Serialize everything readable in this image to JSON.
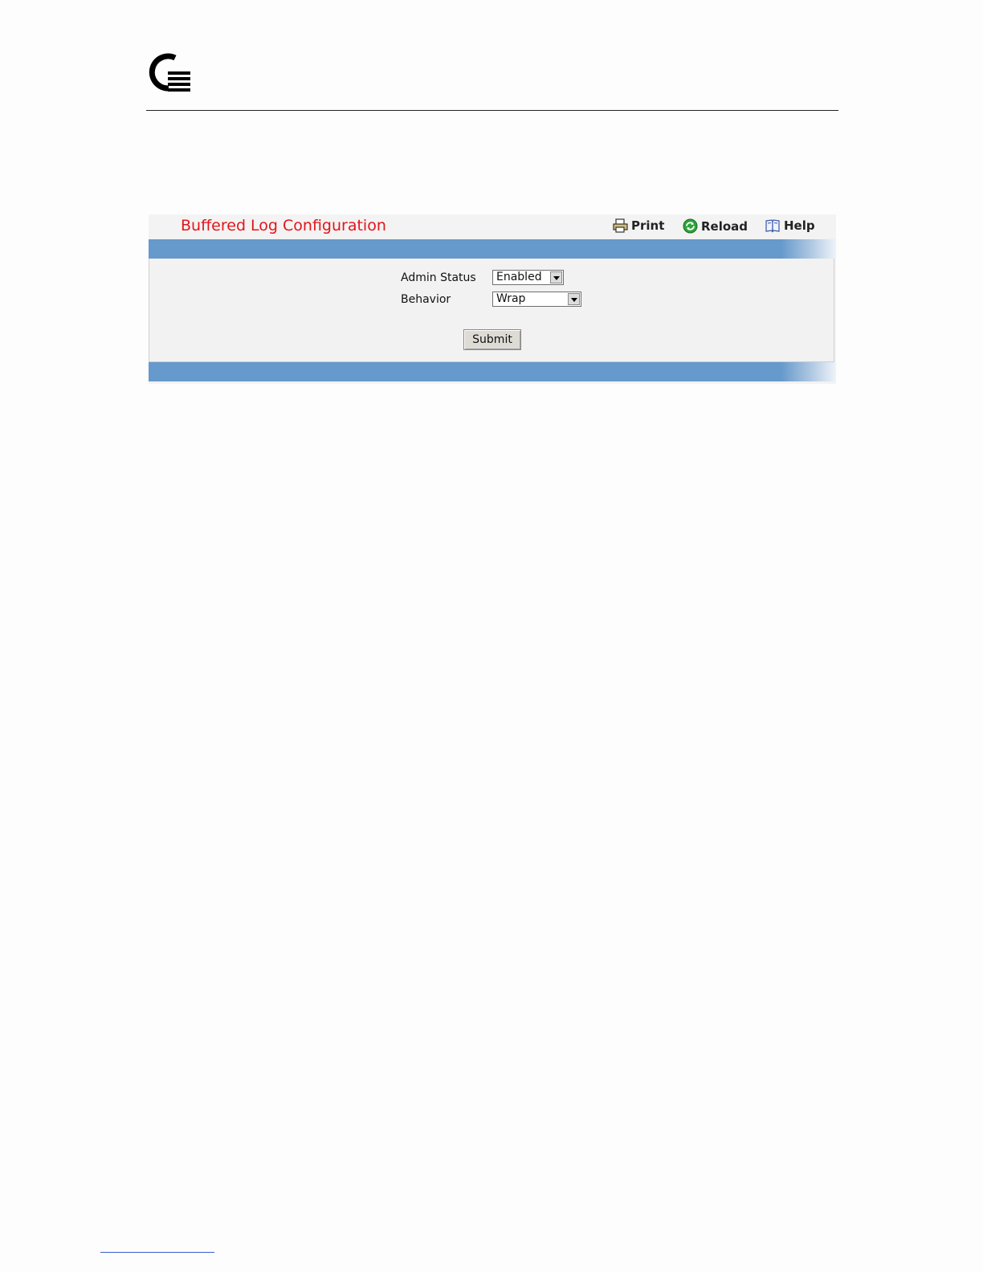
{
  "header": {
    "logo_icon": "company-logo-icon"
  },
  "panel": {
    "title": "Buffered Log Configuration",
    "tools": {
      "print_label": "Print",
      "reload_label": "Reload",
      "help_label": "Help"
    },
    "band_color": "#6699cc",
    "title_color": "#e4141b"
  },
  "form": {
    "admin_status": {
      "label": "Admin Status",
      "selected": "Enabled"
    },
    "behavior": {
      "label": "Behavior",
      "selected": "Wrap"
    },
    "submit_label": "Submit"
  }
}
